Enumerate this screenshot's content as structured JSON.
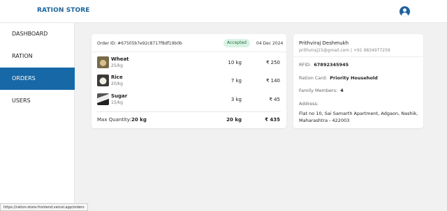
{
  "app": {
    "title": "RATION STORE"
  },
  "sidebar": {
    "items": [
      {
        "label": "DASHBOARD"
      },
      {
        "label": "RATION"
      },
      {
        "label": "ORDERS"
      },
      {
        "label": "USERS"
      }
    ],
    "active": "ORDERS"
  },
  "order": {
    "id_label": "Order ID: #67505b7e92c8717f8df19b0b",
    "status": "Accepted",
    "date": "04 Dec 2024",
    "items": [
      {
        "name": "Wheat",
        "price": "25/kg",
        "qty": "10 kg",
        "total": "₹ 250"
      },
      {
        "name": "Rice",
        "price": "20/kg",
        "qty": "7 kg",
        "total": "₹ 140"
      },
      {
        "name": "Sugar",
        "price": "15/kg",
        "qty": "3 kg",
        "total": "₹ 45"
      }
    ],
    "max_quantity_label": "Max Quantity:",
    "max_quantity_value": "20 kg",
    "total_qty": "20 kg",
    "grand_total": "₹ 435"
  },
  "customer": {
    "name": "Prithviraj Deshmukh",
    "contact": "prithviraj15@gmail.com | +91 9834977259",
    "rfid_label": "RFID:",
    "rfid_value": "67892345945",
    "ration_card_label": "Ration Card:",
    "ration_card_value": "Priority Household",
    "family_label": "Family Members:",
    "family_value": "4",
    "address_label": "Address:",
    "address": "Flat no 10, Sai Samarth Apartment, Adgaon, Nashik, Maharashtra - 422003"
  },
  "status_bar": {
    "url": "https://ration-store-frontend.vercel.app/orders"
  },
  "colors": {
    "brand": "#1565a8",
    "active_nav": "#1668a6",
    "badge_bg": "#d8f3e4"
  },
  "icons": {
    "avatar": "user-circle-icon"
  }
}
